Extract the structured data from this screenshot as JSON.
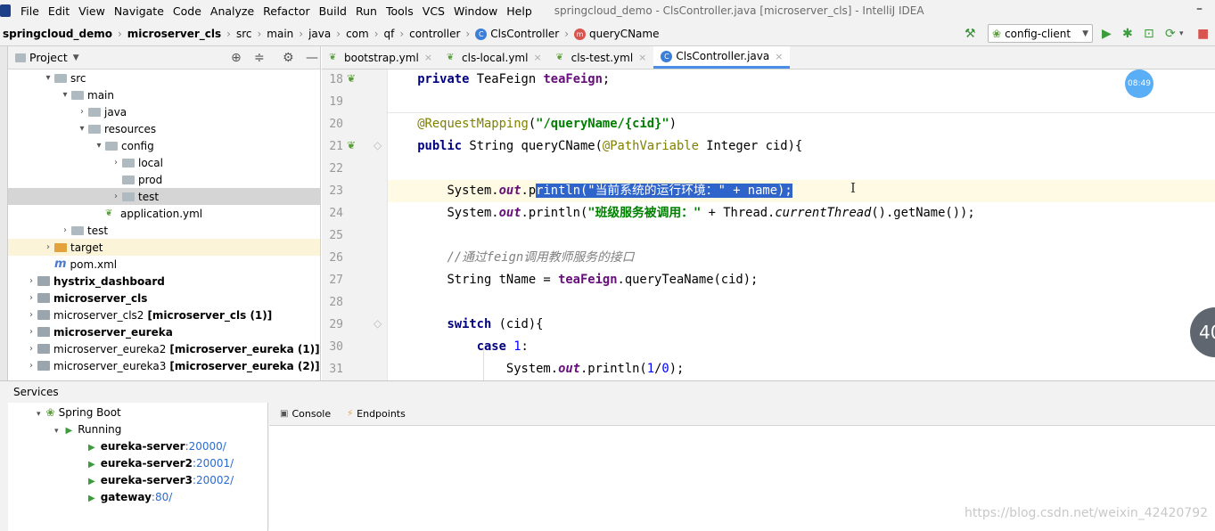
{
  "menu": {
    "items": [
      "File",
      "Edit",
      "View",
      "Navigate",
      "Code",
      "Analyze",
      "Refactor",
      "Build",
      "Run",
      "Tools",
      "VCS",
      "Window",
      "Help"
    ],
    "window_title": "springcloud_demo - ClsController.java [microserver_cls] - IntelliJ IDEA",
    "minimize": "–"
  },
  "breadcrumbs": [
    "springcloud_demo",
    "microserver_cls",
    "src",
    "main",
    "java",
    "com",
    "qf",
    "controller",
    "ClsController",
    "queryCName"
  ],
  "run_config": "config-client",
  "project": {
    "title": "Project",
    "tree": [
      {
        "label": "src",
        "indent": 2,
        "arrow": "▾",
        "icon": "folder"
      },
      {
        "label": "main",
        "indent": 3,
        "arrow": "▾",
        "icon": "folder"
      },
      {
        "label": "java",
        "indent": 4,
        "arrow": "›",
        "icon": "folder"
      },
      {
        "label": "resources",
        "indent": 4,
        "arrow": "▾",
        "icon": "folder"
      },
      {
        "label": "config",
        "indent": 5,
        "arrow": "▾",
        "icon": "folder"
      },
      {
        "label": "local",
        "indent": 6,
        "arrow": "›",
        "icon": "folder"
      },
      {
        "label": "prod",
        "indent": 6,
        "arrow": "",
        "icon": "folder"
      },
      {
        "label": "test",
        "indent": 6,
        "arrow": "›",
        "icon": "folder",
        "selected": true
      },
      {
        "label": "application.yml",
        "indent": 5,
        "arrow": "",
        "icon": "yml"
      },
      {
        "label": "test",
        "indent": 3,
        "arrow": "›",
        "icon": "folder"
      },
      {
        "label": "target",
        "indent": 2,
        "arrow": "›",
        "icon": "folder-orange",
        "highlight": true
      },
      {
        "label": "pom.xml",
        "indent": 2,
        "arrow": "",
        "icon": "maven"
      },
      {
        "label": "hystrix_dashboard",
        "indent": 1,
        "arrow": "›",
        "icon": "module",
        "bold": true
      },
      {
        "label": "microserver_cls",
        "indent": 1,
        "arrow": "›",
        "icon": "module",
        "bold": true
      },
      {
        "label": "microserver_cls2",
        "suffix": "[microserver_cls (1)]",
        "indent": 1,
        "arrow": "›",
        "icon": "module"
      },
      {
        "label": "microserver_eureka",
        "indent": 1,
        "arrow": "›",
        "icon": "module",
        "bold": true
      },
      {
        "label": "microserver_eureka2",
        "suffix": "[microserver_eureka (1)]",
        "indent": 1,
        "arrow": "›",
        "icon": "module"
      },
      {
        "label": "microserver_eureka3",
        "suffix": "[microserver_eureka (2)]",
        "indent": 1,
        "arrow": "›",
        "icon": "module"
      }
    ]
  },
  "tabs": [
    {
      "label": "bootstrap.yml",
      "icon": "yml"
    },
    {
      "label": "cls-local.yml",
      "icon": "yml"
    },
    {
      "label": "cls-test.yml",
      "icon": "yml"
    },
    {
      "label": "ClsController.java",
      "icon": "class",
      "active": true
    }
  ],
  "editor": {
    "lines": [
      {
        "n": "18",
        "html": "    <span class='kw'>private</span> TeaFeign <span class='fd'>teaFeign</span>;"
      },
      {
        "n": "19",
        "html": ""
      },
      {
        "n": "20",
        "html": "    <span class='an'>@RequestMapping</span>(<span class='st'>\"/queryName/{cid}\"</span>)"
      },
      {
        "n": "21",
        "html": "    <span class='kw'>public</span> String queryCName(<span class='an'>@PathVariable</span> Integer cid){"
      },
      {
        "n": "22",
        "html": ""
      },
      {
        "n": "23",
        "html": "        System.<span class='fd it'>out</span>.p<span class='selt'>rintln(\"当前系统的运行环境：\" + name);</span>",
        "current": true
      },
      {
        "n": "24",
        "html": "        System.<span class='fd it'>out</span>.println(<span class='st'>\"班级服务被调用：\"</span> + Thread.<span class='it'>currentThread</span>().getName());"
      },
      {
        "n": "25",
        "html": ""
      },
      {
        "n": "26",
        "html": "        <span class='cm'>//通过feign调用教师服务的接口</span>"
      },
      {
        "n": "27",
        "html": "        String tName = <span class='fd'>teaFeign</span>.queryTeaName(cid);"
      },
      {
        "n": "28",
        "html": ""
      },
      {
        "n": "29",
        "html": "        <span class='kw'>switch</span> (cid){"
      },
      {
        "n": "30",
        "html": "            <span class='kw'>case</span> <span class='nm'>1</span>:"
      },
      {
        "n": "31",
        "html": "                System.<span class='fd it'>out</span>.println(<span class='nm'>1</span>/<span class='nm'>0</span>);"
      }
    ],
    "badge_time": "08:49",
    "float_badge": "40"
  },
  "services": {
    "title": "Services",
    "tabs": [
      "Console",
      "Endpoints"
    ],
    "spring_boot": "Spring Boot",
    "running": "Running",
    "items": [
      {
        "name": "eureka-server",
        "port": ":20000/"
      },
      {
        "name": "eureka-server2",
        "port": ":20001/"
      },
      {
        "name": "eureka-server3",
        "port": ":20002/"
      },
      {
        "name": "gateway",
        "port": ":80/"
      }
    ]
  },
  "watermark": "https://blog.csdn.net/weixin_42420792",
  "colors": {
    "selection": "#2f65ca",
    "accent": "#4b8ee8",
    "current_line": "#fffae3"
  }
}
